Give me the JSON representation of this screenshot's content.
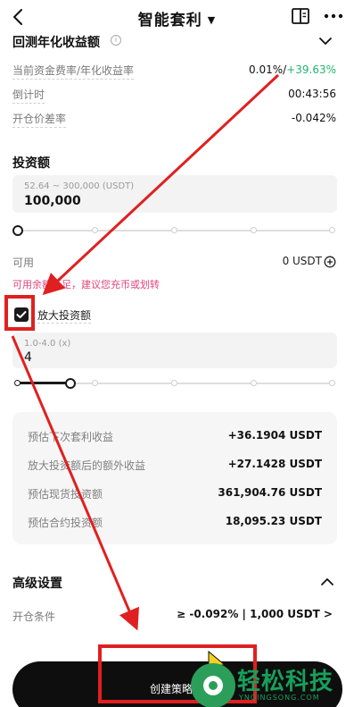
{
  "header": {
    "title": "智能套利",
    "title_caret": "▼"
  },
  "summary": {
    "title": "回测年化收益额",
    "rows": [
      {
        "label": "当前资金费率/年化收益率",
        "value_main": "0.01%/",
        "value_green": "+39.63%"
      },
      {
        "label": "倒计时",
        "value_main": "00:43:56",
        "value_green": ""
      },
      {
        "label": "开仓价差率",
        "value_main": "-0.042%",
        "value_green": ""
      }
    ]
  },
  "investment": {
    "title": "投资额",
    "hint": "52.64 ~ 300,000 (USDT)",
    "value": "100,000",
    "slider_fraction": 0,
    "available_label": "可用",
    "available_value": "0 USDT",
    "warning": "可用余额不足，建议您充币或划转"
  },
  "amplify": {
    "checked": true,
    "label": "放大投资额",
    "hint": "1.0-4.0 (x)",
    "value": "4",
    "slider_fraction": 0.19
  },
  "estimates": [
    {
      "label": "预估下次套利收益",
      "value": "+36.1904 USDT",
      "green": true
    },
    {
      "label": "放大投资额后的额外收益",
      "value": "+27.1428 USDT",
      "green": true
    },
    {
      "label": "预估现货投资额",
      "value": "361,904.76 USDT",
      "green": false
    },
    {
      "label": "预估合约投资额",
      "value": "18,095.23 USDT",
      "green": false
    }
  ],
  "advanced": {
    "title": "高级设置",
    "open_condition_label": "开仓条件",
    "open_condition_value": "≥ -0.092%  |  1,000 USDT >"
  },
  "cta": {
    "label": "创建策略"
  },
  "watermark": {
    "text": "轻松科技",
    "sub": "YNQINGSONG.COM"
  },
  "colors": {
    "accent_green": "#21b66d",
    "warning_pink": "#e0457b",
    "annotation_red": "#e02020"
  }
}
